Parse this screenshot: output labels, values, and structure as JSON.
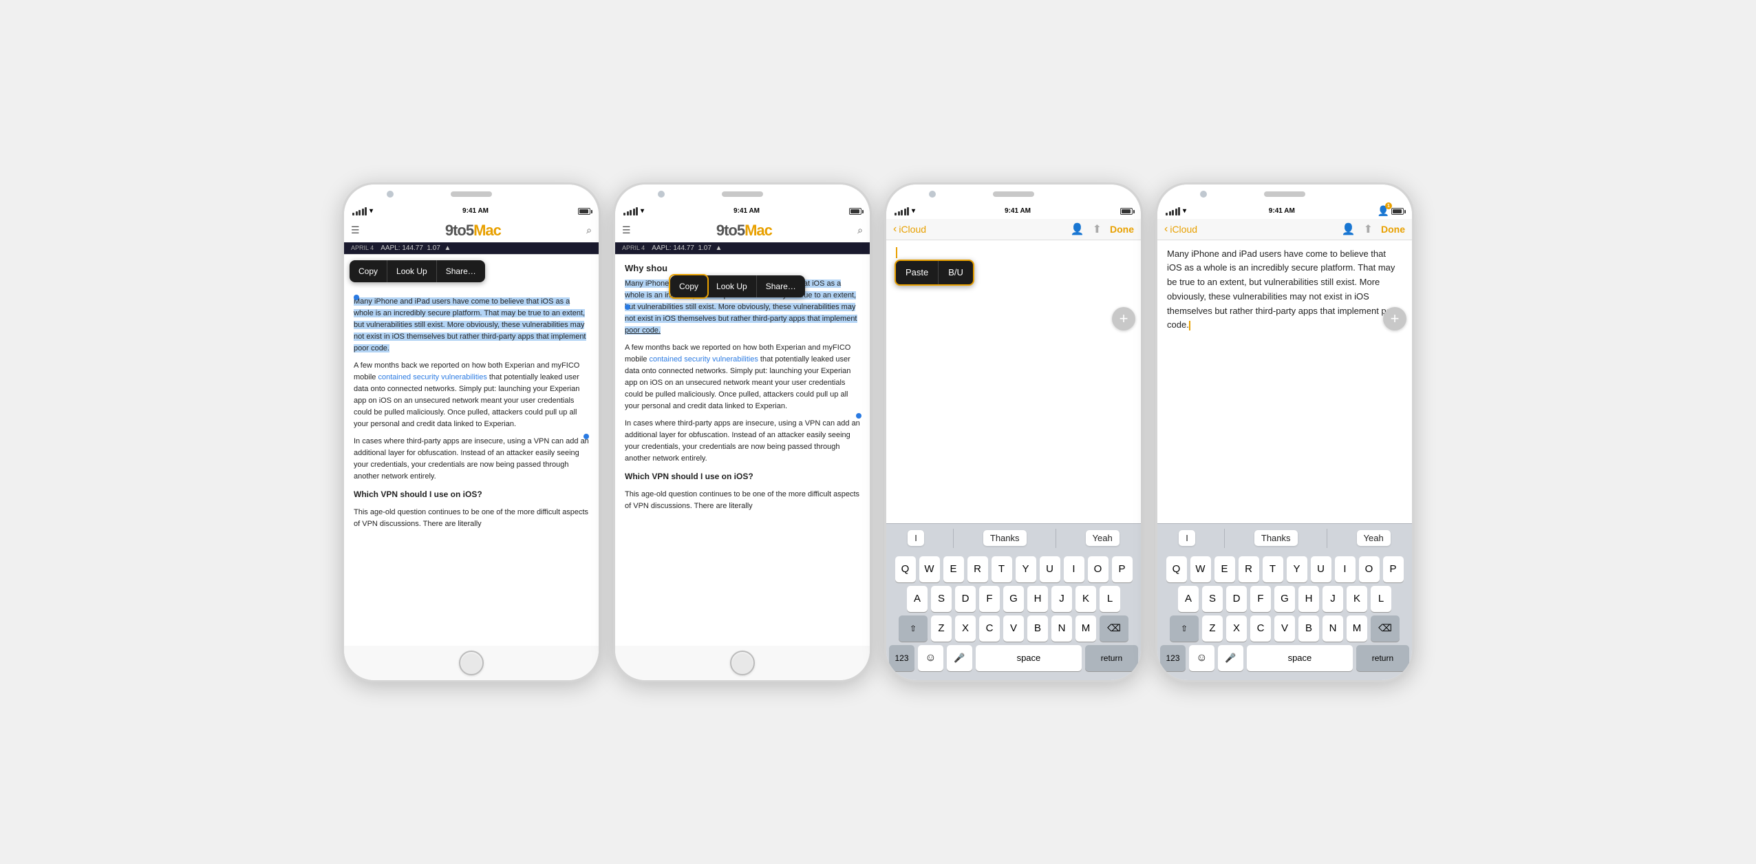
{
  "phones": [
    {
      "id": "phone1",
      "app": "safari",
      "status": {
        "signal_dots": 5,
        "wifi": true,
        "time": "9:41 AM",
        "url": "9to5mac.com",
        "battery": 80
      },
      "header": {
        "logo": "9to5Mac",
        "date": "APRIL 4",
        "stock": "AAPL: 144.77",
        "change": "1.07",
        "arrow": "▲"
      },
      "context_menu": {
        "visible": true,
        "highlighted": "Copy",
        "items": [
          "Copy",
          "Look Up",
          "Share…"
        ]
      },
      "content": {
        "paragraph1": "Many iPhone and iPad users have come to believe that iOS as a whole is an incredibly secure platform. That may be true to an extent, but vulnerabilities still exist. More obviously, these vulnerabilities may not exist in iOS themselves but rather third-party apps that implement poor code.",
        "paragraph2": "A few months back we reported on how both Experian and myFICO mobile contained security vulnerabilities that potentially leaked user data onto connected networks. Simply put: launching your Experian app on iOS on an unsecured network meant your user credentials could be pulled maliciously. Once pulled, attackers could pull up all your personal and credit data linked to Experian.",
        "paragraph3": "In cases where third-party apps are insecure, using a VPN can add an additional layer for obfuscation. Instead of an attacker easily seeing your credentials, your credentials are now being passed through another network entirely.",
        "heading1": "Which VPN should I use on iOS?",
        "paragraph4": "This age-old question continues to be one of the more difficult aspects of VPN discussions. There are literally"
      }
    },
    {
      "id": "phone2",
      "app": "safari",
      "status": {
        "time": "9:41 AM",
        "url": "9to5mac.com"
      },
      "header": {
        "logo": "9to5Mac",
        "date": "APRIL 4",
        "stock": "AAPL: 144.77",
        "change": "1.07"
      },
      "context_menu": {
        "visible": true,
        "highlighted": "Copy",
        "items": [
          "Copy",
          "Look Up",
          "Share…"
        ]
      },
      "content": {
        "heading_why": "Why shou",
        "paragraph1": "Many iPhone and iPad users have come to believe that iOS as a whole is an incredibly secure platform. That may be true to an extent, but vulnerabilities still exist. More obviously, these vulnerabilities may not exist in iOS themselves but rather third-party apps that implement poor code.",
        "selected_suffix": "poor code.",
        "paragraph2": "A few months back we reported on how both Experian and myFICO mobile contained security vulnerabilities that potentially leaked user data onto connected networks. Simply put: launching your Experian app on iOS on an unsecured network meant your user credentials could be pulled maliciously. Once pulled, attackers could pull up all your personal and credit data linked to Experian.",
        "paragraph3": "In cases where third-party apps are insecure, using a VPN can add an additional layer for obfuscation. Instead of an attacker easily seeing your credentials, your credentials are now being passed through another network entirely.",
        "heading1": "Which VPN should I use on iOS?",
        "paragraph4": "This age-old question continues to be one of the more difficult aspects of VPN discussions. There are literally"
      }
    },
    {
      "id": "phone3",
      "app": "notes",
      "status": {
        "time": "9:41 AM"
      },
      "header": {
        "back_label": "iCloud",
        "done_label": "Done"
      },
      "paste_menu": {
        "items": [
          "Paste",
          "B/U"
        ]
      },
      "content": {
        "body": "",
        "cursor_visible": true
      },
      "quick_type": [
        "I",
        "Thanks",
        "Yeah"
      ],
      "keyboard": {
        "rows": [
          [
            "Q",
            "W",
            "E",
            "R",
            "T",
            "Y",
            "U",
            "I",
            "O",
            "P"
          ],
          [
            "A",
            "S",
            "D",
            "F",
            "G",
            "H",
            "J",
            "K",
            "L"
          ],
          [
            "⇧",
            "Z",
            "X",
            "C",
            "V",
            "B",
            "N",
            "M",
            "⌫"
          ],
          [
            "123",
            "😊",
            "🎤",
            "space",
            "return"
          ]
        ]
      }
    },
    {
      "id": "phone4",
      "app": "notes",
      "status": {
        "time": "9:41 AM"
      },
      "header": {
        "back_label": "iCloud",
        "done_label": "Done"
      },
      "content": {
        "body": "Many iPhone and iPad users have come to believe that iOS as a whole is an incredibly secure platform. That may be true to an extent, but vulnerabilities still exist. More obviously, these vulnerabilities may not exist in iOS themselves but rather third-party apps that implement poor code.",
        "cursor_visible": true
      },
      "quick_type": [
        "I",
        "Thanks",
        "Yeah"
      ],
      "keyboard": {
        "rows": [
          [
            "Q",
            "W",
            "E",
            "R",
            "T",
            "Y",
            "U",
            "I",
            "O",
            "P"
          ],
          [
            "A",
            "S",
            "D",
            "F",
            "G",
            "H",
            "J",
            "K",
            "L"
          ],
          [
            "⇧",
            "Z",
            "X",
            "C",
            "V",
            "B",
            "N",
            "M",
            "⌫"
          ],
          [
            "123",
            "😊",
            "🎤",
            "space",
            "return"
          ]
        ]
      }
    }
  ],
  "accent_color": "#e8a000",
  "selection_color": "#b3d4f5",
  "link_color": "#2a7ae2"
}
